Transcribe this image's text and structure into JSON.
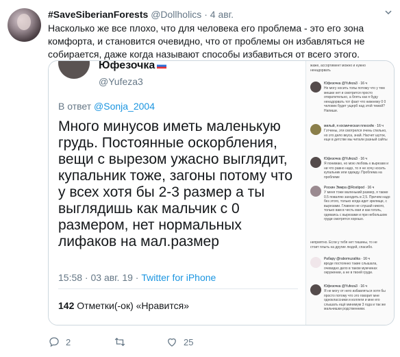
{
  "tweet": {
    "name": "#SaveSiberianForests",
    "handle": "@Dollholics",
    "dot": "·",
    "time": "4 авг.",
    "text": "Насколько же все плохо, что для человека его проблема - это его зона комфорта, и становится очевидно, что от проблемы он избавляться не собирается,  даже когда называют способы избавиться от всего этого."
  },
  "quoted": {
    "name": "Юфезочка",
    "handle": "@Yufeza3",
    "reply_prefix": "В ответ",
    "reply_to": "@Sonja_2004",
    "body": "Много минусов иметь маленькую грудь. Постоянные оскорбления, вещи с вырезом ужасно выглядит, купальник тоже, загоны потому что у всех хотя бы 2-3 размер а ты выглядишь как мальчик с 0 размером, нет нормальных лифаков на мал.размер",
    "time": "15:58 · 03 авг. 19 ·",
    "client": "Twitter for iPhone",
    "retweets": "142",
    "stats_text": "Отметки(-ок) «Нравится»"
  },
  "side_comments": [
    {
      "name": "",
      "text": "жаже, ассортимент можно и нужно ненадорвать"
    },
    {
      "name": "Юфезочка @Yufeza3 · 16 ч",
      "text": "Не могу носить топы потому что у тем мешки нет и смотрится просто отвратительно, а блять как я буду ненадорвать тот факт что нижнему 0 0 человек будет ущерб над этой темой? Напиши."
    },
    {
      "name": "милый, я космическая плюсейк · 16 ч",
      "text": "Гэтчины, эти смотрелся очень стильно, но это дело вкуса, знай. Насчет шуток, еще в детстве мы читали разный сайты"
    },
    {
      "name": "Юфезочка @Yufeza3 · 16 ч",
      "text": "Я понимаю, но мою любовь к вырезам и ни что равно надо, то я не хочу носить купальник или одежду. Проблема на проблеме"
    },
    {
      "name": "Роскин Эмира @Rostipod · 16 ч",
      "text": "У меня тоже маленький размер, я также 0.5 поваляю заходить в 2,5. Причем надо без этого, только когда идет зрелище, с вырезами. Главное не слушай никого, только вам в честь мая и как гоголь, одеваясь с вырезами и при небольшом груди смотрятся хорошо."
    },
    {
      "name": "",
      "text": "неприятно. Если у тебя нет тишины, то не стоит плыть на другие людей, спасибо."
    },
    {
      "name": "Рабару @rabomuzalika · 16 ч",
      "text": "вроде постоянно такие слышала, очевидно дело в таком мужчинах окружении, а не в твоей груди."
    },
    {
      "name": "Юфезочка @Yufeza3 · 16 ч",
      "text": "Я не могу от него избавляться хотя бы просто потому что это говорит мне одноклассники и коллеги и мне его слышать ещё минимум 3 года и так же мальчишки родственники."
    }
  ],
  "actions": {
    "reply_count": "2",
    "retweet_count": "",
    "like_count": "25"
  },
  "colors": {
    "link": "#1b95e0",
    "muted": "#657786",
    "text": "#14171a",
    "border": "#ccd6dd"
  }
}
